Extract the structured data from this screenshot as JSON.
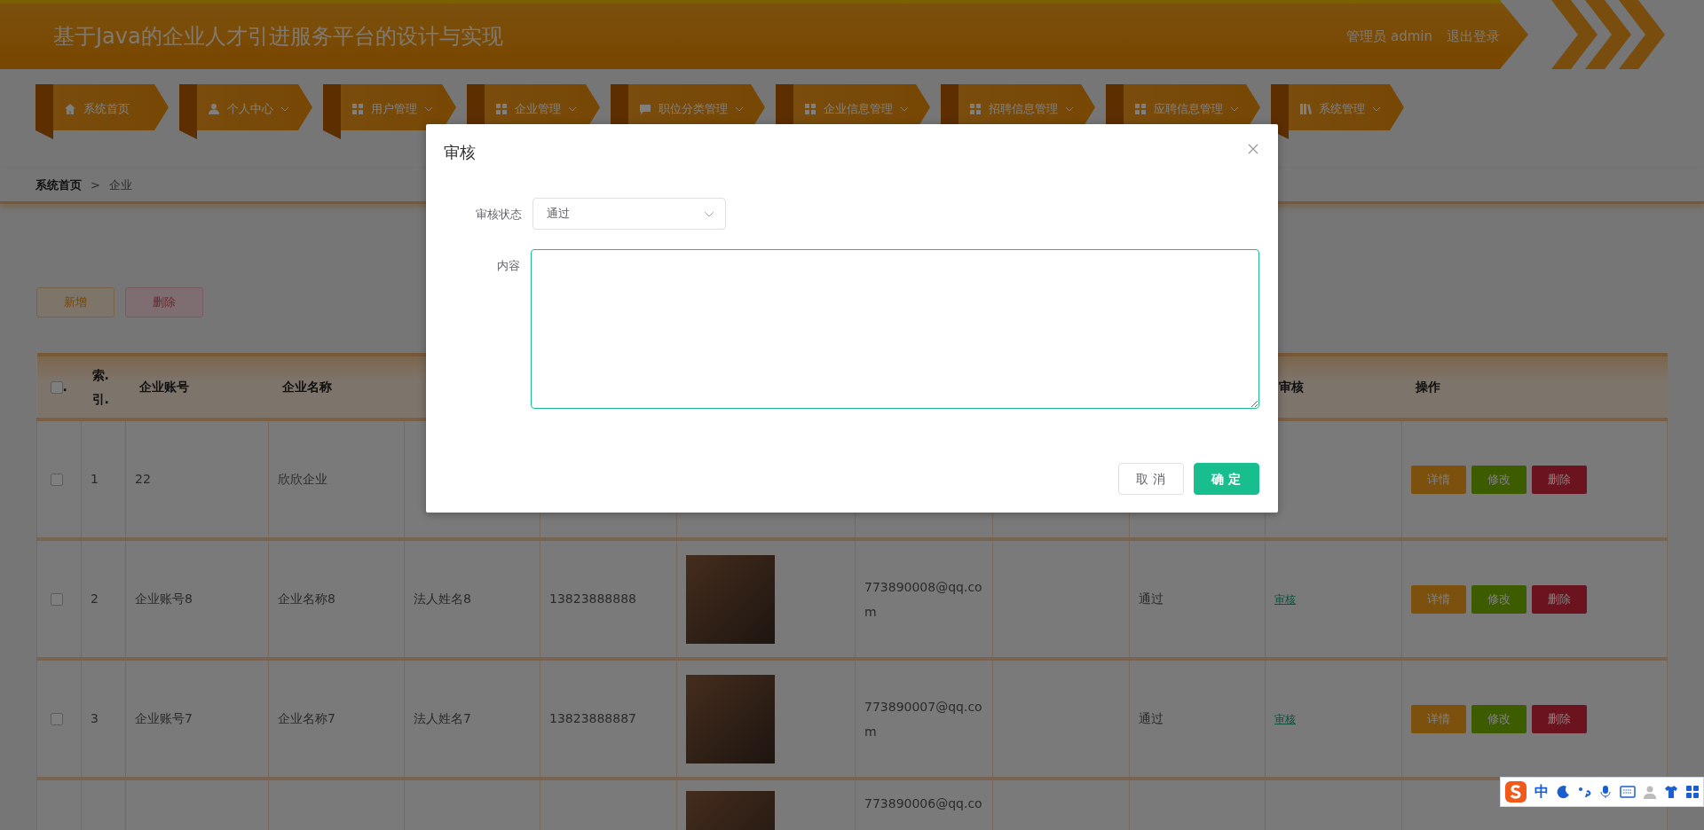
{
  "header": {
    "title": "基于Java的企业人才引进服务平台的设计与实现",
    "user_label": "管理员 admin",
    "logout": "退出登录"
  },
  "nav": [
    {
      "label": "系统首页",
      "dropdown": false
    },
    {
      "label": "个人中心",
      "dropdown": true
    },
    {
      "label": "用户管理",
      "dropdown": true
    },
    {
      "label": "企业管理",
      "dropdown": true
    },
    {
      "label": "职位分类管理",
      "dropdown": true
    },
    {
      "label": "企业信息管理",
      "dropdown": true
    },
    {
      "label": "招聘信息管理",
      "dropdown": true
    },
    {
      "label": "应聘信息管理",
      "dropdown": true
    },
    {
      "label": "系统管理",
      "dropdown": true
    }
  ],
  "breadcrumb": {
    "items": [
      "系统首页",
      "企业"
    ],
    "separator": ">"
  },
  "toolbar": [
    {
      "label": "新增",
      "kind": "add"
    },
    {
      "label": "删除",
      "kind": "delete"
    }
  ],
  "table": {
    "select_all": {
      "checked": false,
      "label": "."
    },
    "columns": [
      "索.引.",
      "企业账号",
      "企业名称",
      null,
      null,
      null,
      null,
      null,
      null,
      "审核",
      "操作"
    ],
    "rows": [
      {
        "checked": false,
        "index": "1",
        "account": "22",
        "company_name": "欣欣企业",
        "actions": [
          {
            "label": "详情",
            "kind": "detail"
          },
          {
            "label": "修改",
            "kind": "edit"
          },
          {
            "label": "删除",
            "kind": "delete"
          }
        ]
      },
      {
        "checked": false,
        "index": "2",
        "account": "企业账号8",
        "company_name": "企业名称8",
        "legal_person": "法人姓名8",
        "phone": "13823888888",
        "photo": true,
        "email": "773890008@qq.com",
        "status": "通过",
        "review_link": "审核",
        "actions": [
          {
            "label": "详情",
            "kind": "detail"
          },
          {
            "label": "修改",
            "kind": "edit"
          },
          {
            "label": "删除",
            "kind": "delete"
          }
        ]
      },
      {
        "checked": false,
        "index": "3",
        "account": "企业账号7",
        "company_name": "企业名称7",
        "legal_person": "法人姓名7",
        "phone": "13823888887",
        "photo": true,
        "email": "773890007@qq.com",
        "status": "通过",
        "review_link": "审核",
        "actions": [
          {
            "label": "详情",
            "kind": "detail"
          },
          {
            "label": "修改",
            "kind": "edit"
          },
          {
            "label": "删除",
            "kind": "delete"
          }
        ]
      },
      {
        "photo": true,
        "email": "773890006@qq.co"
      }
    ]
  },
  "modal": {
    "title": "审核",
    "fields": [
      {
        "kind": "select",
        "label": "审核状态",
        "value": "通过",
        "focused": false
      },
      {
        "kind": "textarea",
        "label": "内容",
        "focused": true
      }
    ],
    "buttons": [
      {
        "label": "取消",
        "kind": "cancel"
      },
      {
        "label": "确定",
        "kind": "confirm"
      }
    ]
  },
  "ime_toolbar": {
    "mode": "中"
  }
}
